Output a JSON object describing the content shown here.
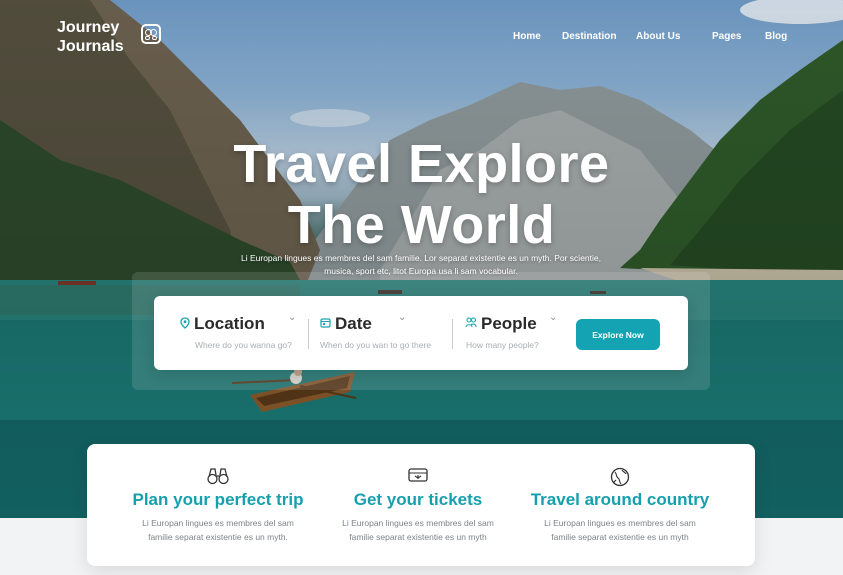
{
  "brand": {
    "name_line1": "Journey",
    "name_line2": "Journals"
  },
  "nav": {
    "items": [
      "Home",
      "Destination",
      "About Us",
      "Pages",
      "Blog"
    ]
  },
  "hero": {
    "title_line1": "Travel Explore",
    "title_line2": "The World",
    "subtitle_line1": "Li Europan lingues es membres del sam familie. Lor separat existentie es un myth. Por scientie,",
    "subtitle_line2": "musica, sport etc, litot Europa usa li sam vocabular."
  },
  "search": {
    "location": {
      "label": "Location",
      "hint": "Where do you wanna go?",
      "icon": "map-pin-icon"
    },
    "date": {
      "label": "Date",
      "hint": "When do you wan to go there",
      "icon": "calendar-icon"
    },
    "people": {
      "label": "People",
      "hint": "How many people?",
      "icon": "people-icon"
    },
    "button_label": "Explore Now"
  },
  "features": [
    {
      "icon": "binoculars-icon",
      "title": "Plan your perfect trip",
      "desc_line1": "Li Europan lingues es membres del sam",
      "desc_line2": "familie separat existentie es un myth."
    },
    {
      "icon": "ticket-icon",
      "title": "Get your tickets",
      "desc_line1": "Li Europan lingues es membres del sam",
      "desc_line2": "familie separat existentie es un myth"
    },
    {
      "icon": "globe-icon",
      "title": "Travel around country",
      "desc_line1": "Li Europan lingues es membres del sam",
      "desc_line2": "familie separat existentie es un myth"
    }
  ],
  "colors": {
    "accent": "#14a3b2",
    "title_accent": "#16a0ae",
    "hint_text": "#a9adb2",
    "body_text": "#7d8287"
  }
}
